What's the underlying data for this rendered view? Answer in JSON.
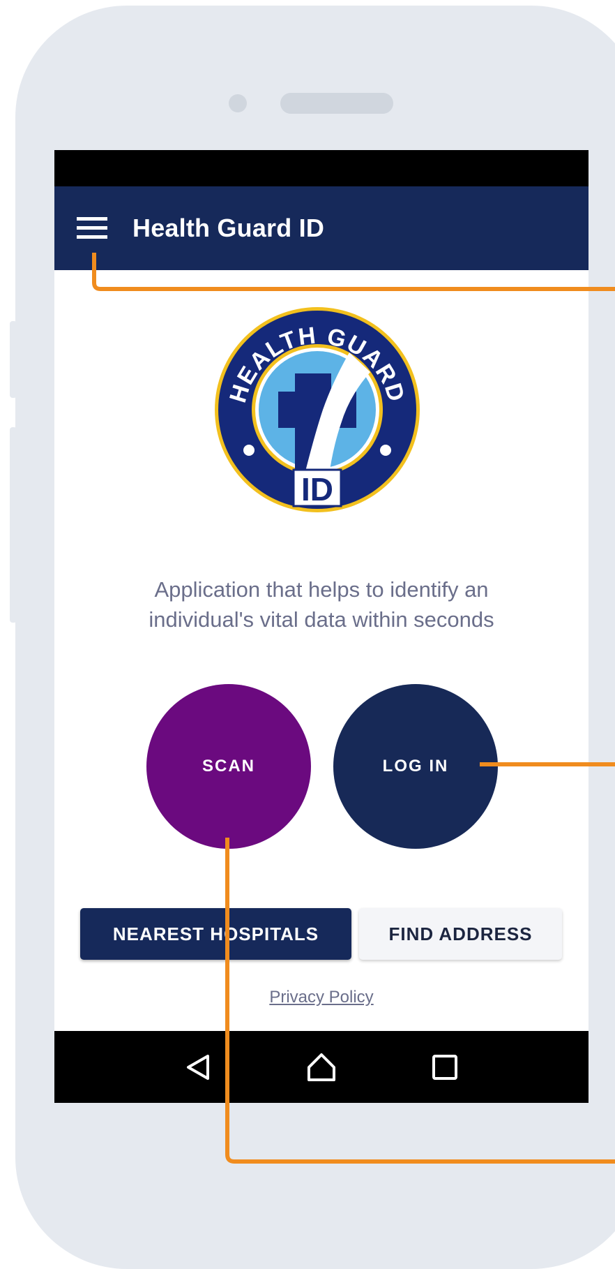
{
  "app": {
    "title": "Health Guard ID"
  },
  "logo": {
    "ring_text": "HEALTH GUARD",
    "badge_text": "ID"
  },
  "main": {
    "tagline_line1": "Application that helps to identify an",
    "tagline_line2": "individual's vital data within seconds",
    "scan_label": "SCAN",
    "login_label": "LOG IN",
    "nearest_hospitals_label": "NEAREST HOSPITALS",
    "find_address_label": "FIND ADDRESS",
    "privacy_label": "Privacy Policy"
  },
  "icons": {
    "menu": "menu-icon",
    "back": "back-icon",
    "home": "home-icon",
    "recents": "recents-icon"
  },
  "colors": {
    "app_bar": "#16295a",
    "scan_button": "#6b0a7f",
    "login_button": "#172957",
    "callout_lines": "#f08c1e",
    "logo_gold": "#f2c01e"
  }
}
